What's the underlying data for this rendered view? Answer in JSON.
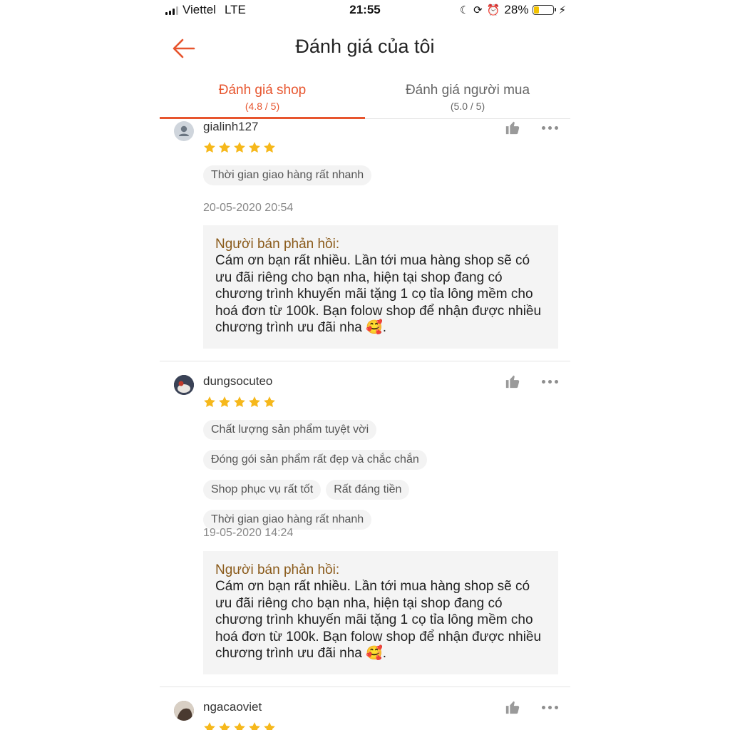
{
  "status_bar": {
    "carrier": "Viettel",
    "network": "LTE",
    "time": "21:55",
    "battery_percent": "28%",
    "battery_level": 0.28
  },
  "header": {
    "title": "Đánh giá của tôi"
  },
  "tabs": [
    {
      "label": "Đánh giá shop",
      "sub": "(4.8 / 5)",
      "active": true
    },
    {
      "label": "Đánh giá người mua",
      "sub": "(5.0 / 5)",
      "active": false
    }
  ],
  "reviews": [
    {
      "username": "gialinh127",
      "rating": 5,
      "tags": [
        "Thời gian giao hàng rất nhanh"
      ],
      "date": "20-05-2020 20:54",
      "reply_label": "Người bán phản hồi:",
      "reply_text": "Cám ơn bạn rất nhiều. Lần tới mua hàng shop sẽ có ưu đãi riêng cho bạn nha, hiện tại shop đang có chương trình khuyến mãi tặng 1 cọ tỉa lông mềm cho hoá đơn từ 100k. Bạn folow shop để nhận được nhiều chương trình ưu đãi nha 🥰."
    },
    {
      "username": "dungsocuteo",
      "rating": 5,
      "tags": [
        "Chất lượng sản phẩm tuyệt vời",
        "Đóng gói sản phẩm rất đẹp và chắc chắn",
        "Shop phục vụ rất tốt",
        "Rất đáng tiền",
        "Thời gian giao hàng rất nhanh"
      ],
      "date": "19-05-2020 14:24",
      "reply_label": "Người bán phản hồi:",
      "reply_text": "Cám ơn bạn rất nhiều. Lần tới mua hàng shop sẽ có ưu đãi riêng cho bạn nha, hiện tại shop đang có chương trình khuyến mãi tặng 1 cọ tỉa lông mềm cho hoá đơn từ 100k. Bạn folow shop để nhận được nhiều chương trình ưu đãi nha 🥰."
    },
    {
      "username": "ngacaoviet",
      "rating": 5
    }
  ],
  "colors": {
    "accent": "#e7552e",
    "star": "#f6b81b",
    "reply_label": "#8a5a1a",
    "tag_bg": "#f3f3f3"
  },
  "icons": {
    "back": "arrow-left-icon",
    "like": "thumbs-up-icon",
    "more": "more-horizontal-icon",
    "star": "star-icon"
  }
}
